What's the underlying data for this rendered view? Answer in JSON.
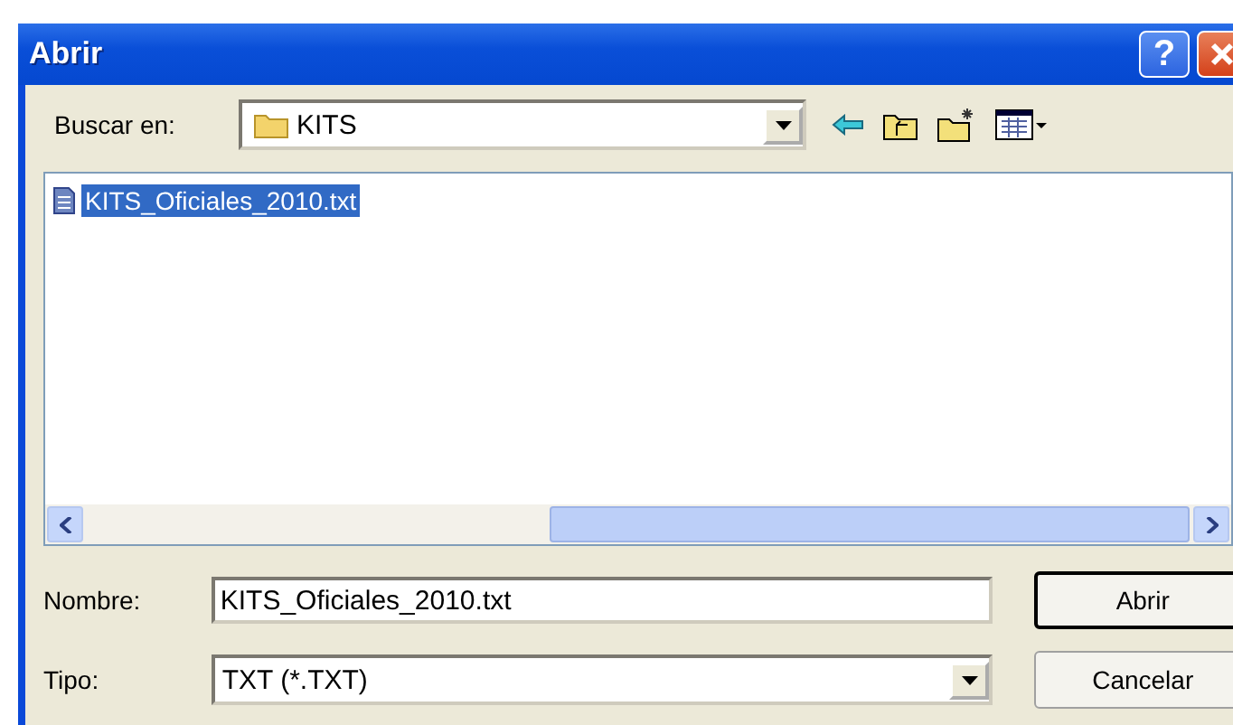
{
  "window": {
    "title": "Abrir",
    "help_button": "?"
  },
  "look_in": {
    "label": "Buscar en:",
    "value": "KITS"
  },
  "files": [
    {
      "name": "KITS_Oficiales_2010.txt",
      "selected": true
    }
  ],
  "file_name": {
    "label": "Nombre:",
    "value": "KITS_Oficiales_2010.txt"
  },
  "file_type": {
    "label": "Tipo:",
    "value": "TXT (*.TXT)"
  },
  "buttons": [
    {
      "label": "Abrir",
      "default": true
    },
    {
      "label": "Cancelar",
      "default": false
    }
  ]
}
